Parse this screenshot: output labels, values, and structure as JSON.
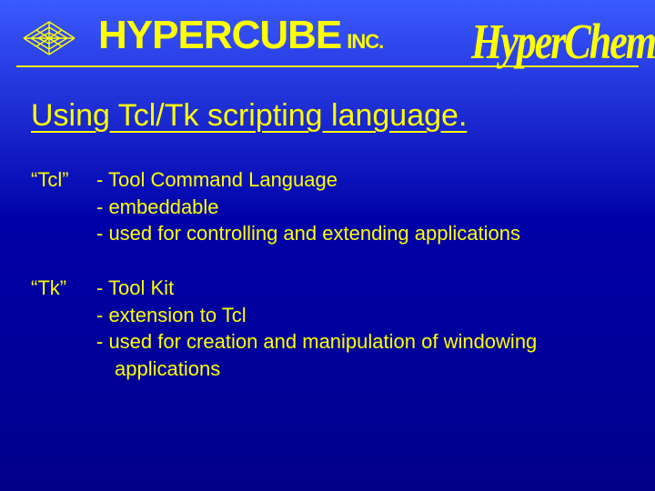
{
  "header": {
    "company_main": "HYPERCUBE",
    "company_suffix": "INC.",
    "product": "HyperChem",
    "logo_name": "hypercube-logo-icon"
  },
  "title": "Using Tcl/Tk scripting language.",
  "items": [
    {
      "term": "“Tcl”",
      "lines": [
        "- Tool Command Language",
        "- embeddable",
        "- used for controlling and extending applications"
      ]
    },
    {
      "term": "“Tk”",
      "lines": [
        "- Tool Kit",
        "- extension to Tcl",
        "- used for creation and manipulation of windowing",
        "  applications"
      ]
    }
  ],
  "colors": {
    "text": "#ffff00",
    "bg_top": "#3a5aff",
    "bg_bottom": "#00008a"
  }
}
